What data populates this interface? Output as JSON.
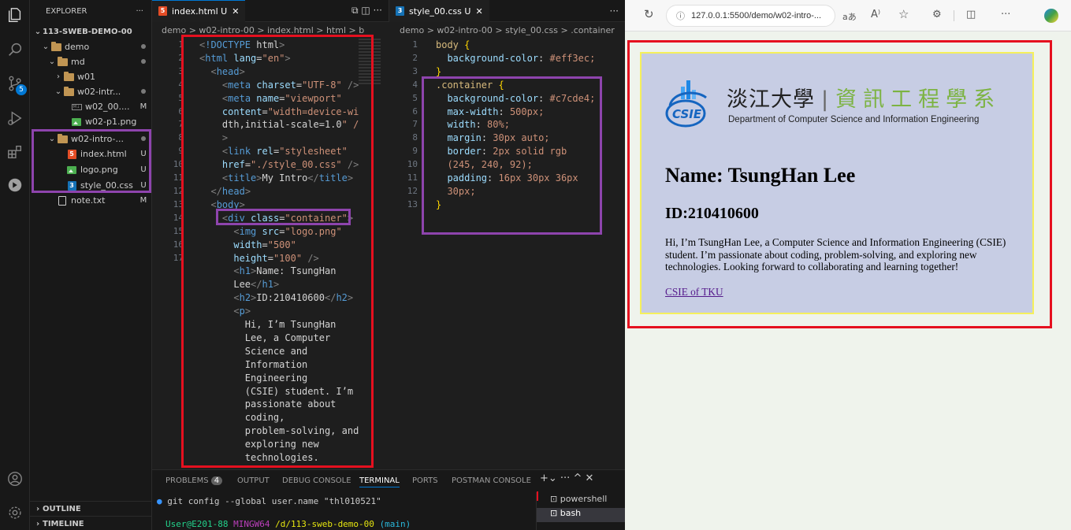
{
  "activity_bar": {
    "source_control_badge": "5"
  },
  "explorer": {
    "title": "EXPLORER",
    "more": "···",
    "root": "113-SWEB-DEMO-00",
    "items": [
      {
        "label": "demo",
        "status": ""
      },
      {
        "label": "md",
        "status": ""
      },
      {
        "label": "w01",
        "status": ""
      },
      {
        "label": "w02-intr...",
        "status": ""
      },
      {
        "label": "w02_00....",
        "status": "M"
      },
      {
        "label": "w02-p1.png",
        "status": ""
      },
      {
        "label": "w02-intro-...",
        "status": ""
      },
      {
        "label": "index.html",
        "status": "U"
      },
      {
        "label": "logo.png",
        "status": "U"
      },
      {
        "label": "style_00.css",
        "status": "U"
      },
      {
        "label": "note.txt",
        "status": "M"
      }
    ],
    "outline": "OUTLINE",
    "timeline": "TIMELINE"
  },
  "editor_html": {
    "tab_label": "index.html U",
    "breadcrumb": "demo > w02-intro-00 > index.html > html > b",
    "line_numbers": [
      "1",
      "2",
      "3",
      "4",
      "5",
      "",
      "",
      "6",
      "",
      "7",
      "8",
      "9",
      "10",
      "11",
      "",
      "",
      "12",
      "",
      "13",
      "14",
      "15",
      "",
      "",
      "",
      "",
      "",
      "16",
      "",
      "",
      "",
      "",
      "17",
      ""
    ],
    "lines": [
      "<!DOCTYPE html>",
      "<html lang=\"en\">",
      "  <head>",
      "    <meta charset=\"UTF-8\" />",
      "    <meta name=\"viewport\"",
      "    content=\"width=device-wi",
      "    dth,initial-scale=1.0\" /",
      "    >",
      "    <link rel=\"stylesheet\"",
      "    href=\"./style_00.css\" />",
      "    <title>My Intro</title>",
      "  </head>",
      "  <body>",
      "    <div class=\"container\">",
      "      <img src=\"logo.png\"",
      "      width=\"500\"",
      "      height=\"100\" />",
      "      <h1>Name: TsungHan",
      "      Lee</h1>",
      "      <h2>ID:210410600</h2>",
      "      <p>",
      "        Hi, I’m TsungHan",
      "        Lee, a Computer",
      "        Science and",
      "        Information",
      "        Engineering",
      "        (CSIE) student. I’m",
      "        passionate about",
      "        coding,",
      "        problem-solving, and",
      "        exploring new",
      "        technologies."
    ]
  },
  "editor_css": {
    "tab_label": "style_00.css U",
    "breadcrumb": "demo > w02-intro-00 > style_00.css > .container",
    "line_numbers": [
      "1",
      "2",
      "3",
      "4",
      "5",
      "6",
      "7",
      "8",
      "9",
      "10",
      "",
      "11",
      "",
      "12",
      "13"
    ],
    "lines": [
      "body {",
      "  background-color: #eff3ec;",
      "}",
      "",
      ".container {",
      "  background-color: #c7cde4;",
      "  max-width: 500px;",
      "  width: 80%;",
      "  margin: 30px auto;",
      "  border: 2px solid rgb",
      "  (245, 240, 92);",
      "  padding: 16px 30px 36px",
      "  30px;",
      "}",
      ""
    ],
    "swatches": {
      "body": "#eff3ec",
      "container": "#c7cde4",
      "border": "#f5f05c"
    }
  },
  "panel": {
    "tabs": [
      "PROBLEMS",
      "OUTPUT",
      "DEBUG CONSOLE",
      "TERMINAL",
      "PORTS",
      "POSTMAN CONSOLE"
    ],
    "problems_count": "4",
    "active_tab": "TERMINAL",
    "terminal_line1": "git config --global user.name \"thl010521\"",
    "prompt_user": "User@E201-88",
    "prompt_env": "MINGW64",
    "prompt_path": "/d/113-sweb-demo-00",
    "prompt_branch": "(main)",
    "terminals": [
      "powershell",
      "bash"
    ]
  },
  "browser": {
    "url": "127.0.0.1:5500/demo/w02-intro-...",
    "logo_cn_left": "淡江大學",
    "logo_cn_right": "資訊工程學系",
    "logo_en": "Department of Computer Science and Information Engineering",
    "logo_mark": "CSIE",
    "h1": "Name: TsungHan Lee",
    "h2": "ID:210410600",
    "paragraph": "Hi, I’m TsungHan Lee, a Computer Science and Information Engineering (CSIE) student. I’m passionate about coding, problem-solving, and exploring new technologies. Looking forward to collaborating and learning together!",
    "link": "CSIE of TKU"
  },
  "colors": {
    "annotation_red": "#e5101f",
    "annotation_purple": "#8e44ad",
    "page_bg": "#eff3ec",
    "container_bg": "#c7cde4"
  }
}
